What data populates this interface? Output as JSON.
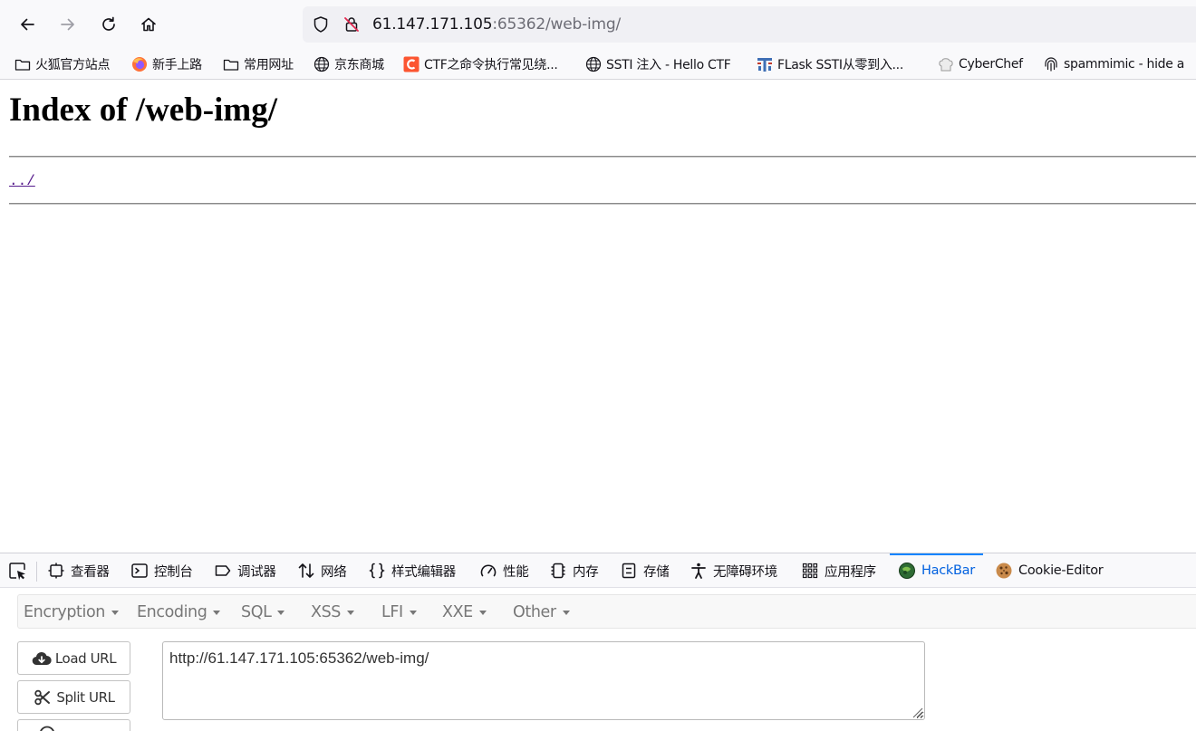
{
  "browser": {
    "url_host": "61.147.171.105",
    "url_rest": ":65362/web-img/"
  },
  "bookmarks": [
    {
      "label": "火狐官方站点",
      "icon": "folder-icon"
    },
    {
      "label": "新手上路",
      "icon": "firefox-icon"
    },
    {
      "label": "常用网址",
      "icon": "folder-icon"
    },
    {
      "label": "京东商城",
      "icon": "globe-icon"
    },
    {
      "label": "CTF之命令执行常见绕...",
      "icon": "csdn-icon"
    },
    {
      "label": "SSTI 注入 - Hello CTF",
      "icon": "globe-icon"
    },
    {
      "label": "FLask SSTI从零到入...",
      "icon": "site-icon"
    },
    {
      "label": "CyberChef",
      "icon": "chef-hat-icon"
    },
    {
      "label": "spammimic - hide a",
      "icon": "fingerprint-icon"
    }
  ],
  "page": {
    "heading": "Index of /web-img/",
    "parent_link": "../"
  },
  "devtools": {
    "tabs": [
      {
        "label": "查看器",
        "icon": "inspector-icon"
      },
      {
        "label": "控制台",
        "icon": "console-icon"
      },
      {
        "label": "调试器",
        "icon": "debugger-icon"
      },
      {
        "label": "网络",
        "icon": "network-icon"
      },
      {
        "label": "样式编辑器",
        "icon": "style-editor-icon"
      },
      {
        "label": "性能",
        "icon": "performance-icon"
      },
      {
        "label": "内存",
        "icon": "memory-icon"
      },
      {
        "label": "存储",
        "icon": "storage-icon"
      },
      {
        "label": "无障碍环境",
        "icon": "accessibility-icon"
      },
      {
        "label": "应用程序",
        "icon": "application-icon"
      },
      {
        "label": "HackBar",
        "icon": "hackbar-icon",
        "active": true
      },
      {
        "label": "Cookie-Editor",
        "icon": "cookie-icon"
      }
    ],
    "accent_color": "#0a84ff"
  },
  "hackbar": {
    "menu": [
      "Encryption",
      "Encoding",
      "SQL",
      "XSS",
      "LFI",
      "XXE",
      "Other"
    ],
    "load_url_label": "Load URL",
    "split_url_label": "Split URL",
    "url_value": "http://61.147.171.105:65362/web-img/"
  }
}
